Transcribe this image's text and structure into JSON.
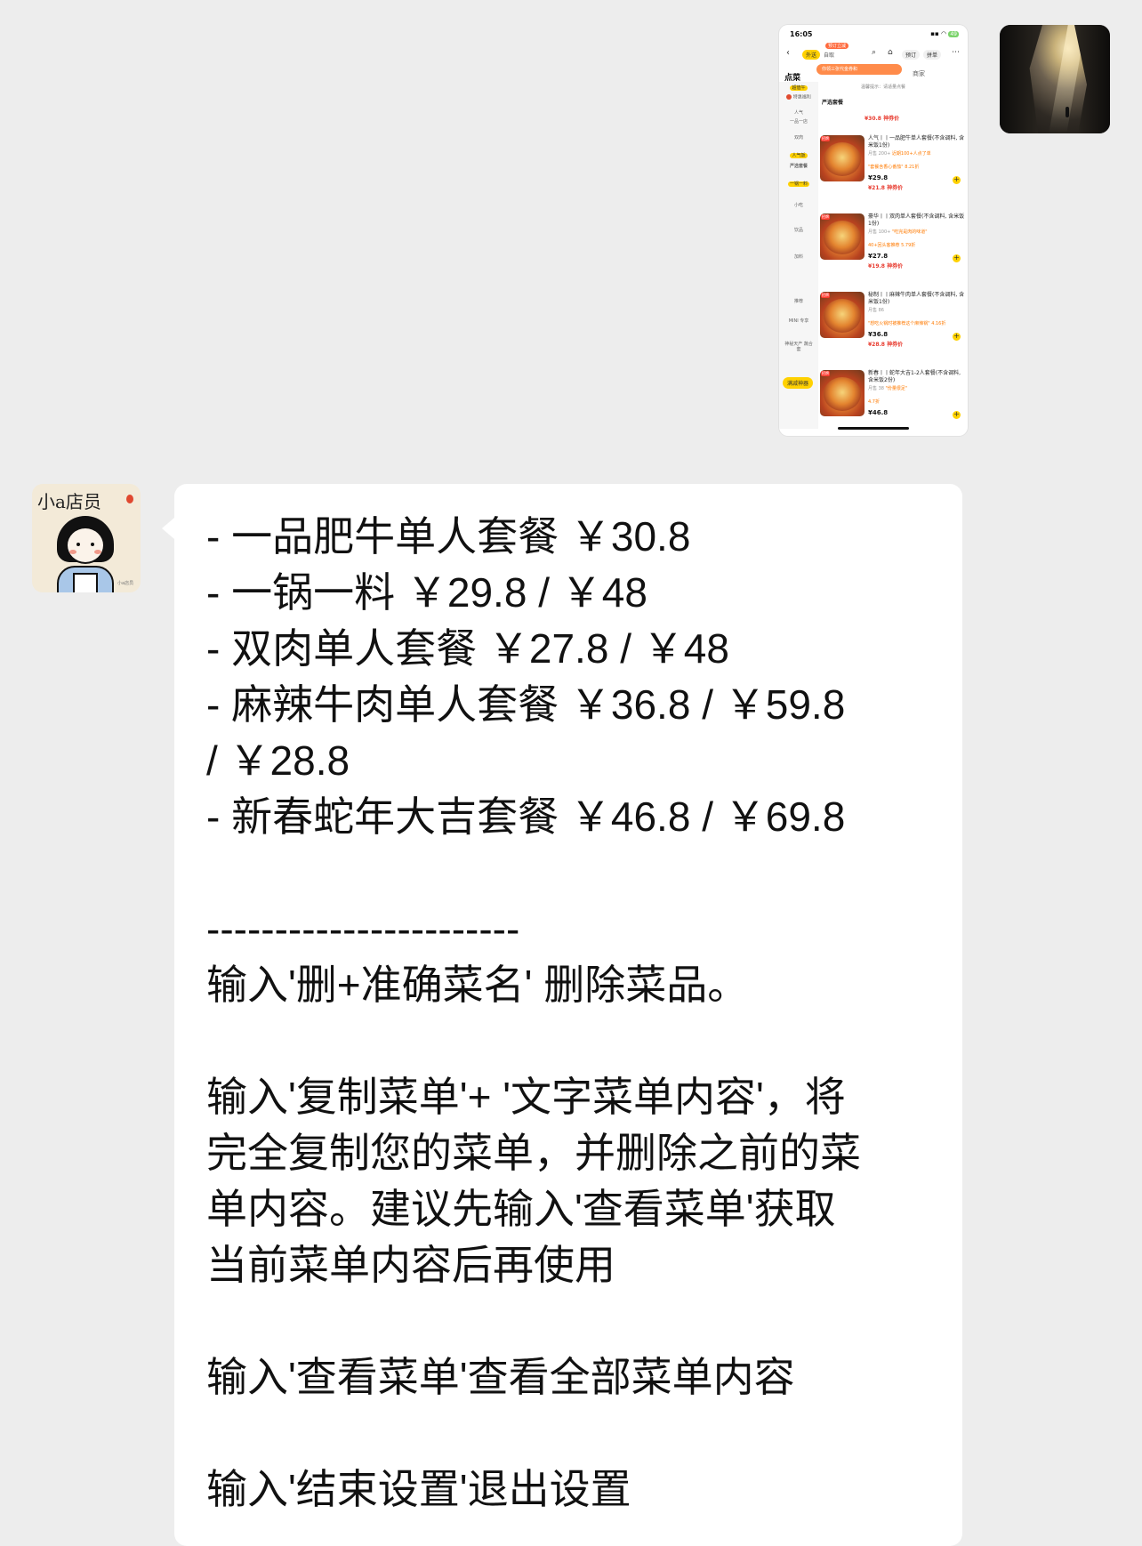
{
  "sent": {
    "screenshot": {
      "status_time": "16:05",
      "battery": "49",
      "tabs": [
        "外送",
        "自取"
      ],
      "tip_badge": "预订立减",
      "coupon_text": "你领三张代金券和 ",
      "chips": [
        "预订",
        "拼单"
      ],
      "section_label": "点菜",
      "merchant_label": "商家",
      "sidebar_items": [
        "超值午",
        "特惠福利",
        "人气",
        "一品一店",
        "双肉",
        "人气饭",
        "严选套餐",
        "一锅一料",
        "小吃",
        "饮品",
        "加料",
        "推荐",
        "MINI 专享",
        "神秘天产 蔬合套"
      ],
      "tip_line": "温馨提示：请适量点餐",
      "section_title": "严选套餐",
      "top_price": "¥30.8 神券价",
      "items": [
        {
          "badge": "招牌",
          "name": "人气丨丨一品肥牛单人套餐(不含调料, 含米饭1份)",
          "meta": "月售 200+",
          "meta_hl": "近期100+人点了单",
          "promo": "\"套餐含香心番茄\"",
          "rating": "8.21折",
          "price": "¥29.8",
          "price2": "¥21.8 神券价"
        },
        {
          "badge": "招牌",
          "name": "豪华丨丨双肉单人套餐(不含调料, 含米饭1份)",
          "meta": "月售 100+",
          "meta_hl": "\"吃完是肉的味道\"",
          "promo": "40+回头客推荐",
          "rating": "5.79折",
          "price": "¥27.8",
          "price2": "¥19.8 神券价"
        },
        {
          "badge": "招牌",
          "name": "秘制丨丨麻辣牛肉单人套餐(不含调料, 含米饭1份)",
          "meta": "月售 86",
          "meta_hl": "",
          "promo": "\"想吃火锅时被推荐这个麻辣锅\"",
          "rating": "4.16折",
          "price": "¥36.8",
          "price2": "¥28.8 神券价"
        },
        {
          "badge": "招牌",
          "name": "新春丨丨蛇年大吉1-2人套餐(不含调料, 含米饭2份)",
          "meta": "月售 38",
          "meta_hl": "\"份量很足\"",
          "promo": "",
          "rating": "4.7折",
          "price": "¥46.8",
          "price2": ""
        }
      ],
      "float_button": "满减神器"
    }
  },
  "received": {
    "avatar_logo": "小a店员",
    "avatar_signature": "小a店员",
    "lines": [
      "- 一品肥牛单人套餐 ￥30.8",
      "- 一锅一料 ￥29.8 / ￥48",
      "- 双肉单人套餐 ￥27.8 / ￥48",
      "- 麻辣牛肉单人套餐 ￥36.8 / ￥59.8",
      "/ ￥28.8",
      "- 新春蛇年大吉套餐 ￥46.8 / ￥69.8",
      "",
      "-----------------------",
      "输入'删+准确菜名' 删除菜品。",
      "",
      "输入'复制菜单'+ '文字菜单内容'，将",
      "完全复制您的菜单，并删除之前的菜",
      "单内容。建议先输入'查看菜单'获取",
      "当前菜单内容后再使用",
      "",
      "输入'查看菜单'查看全部菜单内容",
      "",
      "输入'结束设置'退出设置"
    ]
  }
}
